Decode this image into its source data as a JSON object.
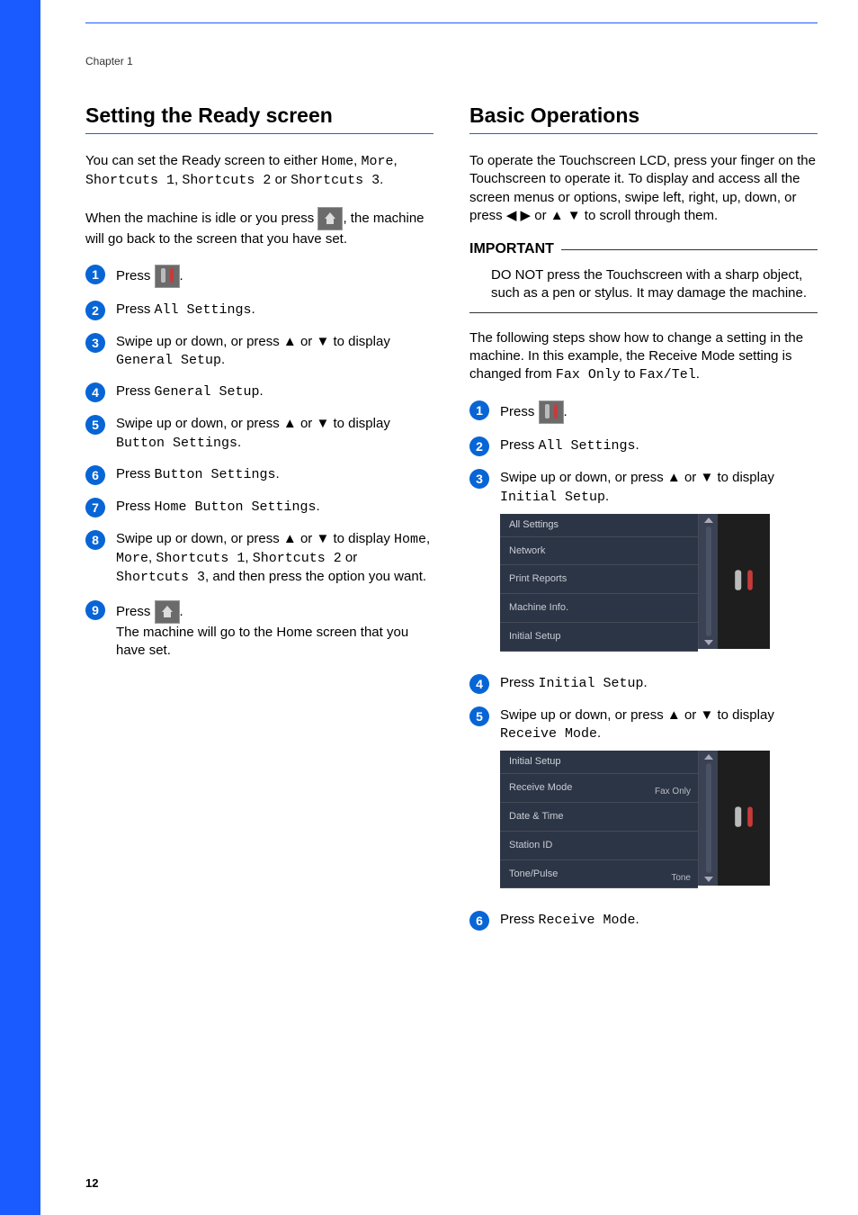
{
  "chapter": "Chapter 1",
  "pageNumber": "12",
  "left": {
    "heading": "Setting the Ready screen",
    "intro_a": "You can set the Ready screen to either ",
    "intro_b": ", ",
    "intro_c": ", ",
    "intro_d": " or ",
    "intro_e": ".",
    "opt_home": "Home",
    "opt_more": "More",
    "opt_s1": "Shortcuts 1",
    "opt_s2": "Shortcuts 2",
    "opt_s3": "Shortcuts 3",
    "idle_a": "When the machine is idle or you press ",
    "idle_b": ", the machine will go back to the screen that you have set.",
    "steps": {
      "s1_a": "Press ",
      "s1_b": ".",
      "s2_a": "Press ",
      "s2_mono": "All Settings",
      "s2_b": ".",
      "s3_a": "Swipe up or down, or press ▲ or ▼ to display ",
      "s3_mono": "General Setup",
      "s3_b": ".",
      "s4_a": "Press ",
      "s4_mono": "General Setup",
      "s4_b": ".",
      "s5_a": "Swipe up or down, or press ▲ or ▼ to display ",
      "s5_mono": "Button Settings",
      "s5_b": ".",
      "s6_a": "Press ",
      "s6_mono": "Button Settings",
      "s6_b": ".",
      "s7_a": "Press ",
      "s7_mono": "Home Button Settings",
      "s7_b": ".",
      "s8_a": "Swipe up or down, or press ▲ or ▼ to display ",
      "s8_m1": "Home",
      "s8_b": ", ",
      "s8_m2": "More",
      "s8_c": ", ",
      "s8_m3": "Shortcuts 1",
      "s8_d": ", ",
      "s8_m4": "Shortcuts 2",
      "s8_e": " or ",
      "s8_m5": "Shortcuts 3",
      "s8_f": ", and then press the option you want.",
      "s9_a": "Press ",
      "s9_b": ".",
      "s9_c": "The machine will go to the Home screen that you have set."
    }
  },
  "right": {
    "heading": "Basic Operations",
    "intro": "To operate the Touchscreen LCD, press your finger on the Touchscreen to operate it. To display and access all the screen menus or options, swipe left, right, up, down, or press ◀ ▶ or ▲ ▼ to scroll through them.",
    "important_title": "IMPORTANT",
    "important_body": "DO NOT press the Touchscreen with a sharp object, such as a pen or stylus. It may damage the machine.",
    "intro2_a": "The following steps show how to change a setting in the machine. In this example, the Receive Mode setting is changed from ",
    "intro2_m1": "Fax Only",
    "intro2_b": " to ",
    "intro2_m2": "Fax/Tel",
    "intro2_c": ".",
    "steps": {
      "s1_a": "Press ",
      "s1_b": ".",
      "s2_a": "Press ",
      "s2_mono": "All Settings",
      "s2_b": ".",
      "s3_a": "Swipe up or down, or press ▲ or ▼ to display ",
      "s3_mono": "Initial Setup",
      "s3_b": ".",
      "s4_a": "Press ",
      "s4_mono": "Initial Setup",
      "s4_b": ".",
      "s5_a": "Swipe up or down, or press ▲ or ▼ to display ",
      "s5_mono": "Receive Mode",
      "s5_b": ".",
      "s6_a": "Press ",
      "s6_mono": "Receive Mode",
      "s6_b": "."
    },
    "screen1": {
      "header": "All Settings",
      "items": [
        "Network",
        "Print Reports",
        "Machine Info.",
        "Initial Setup"
      ]
    },
    "screen2": {
      "header": "Initial Setup",
      "items": [
        {
          "label": "Receive Mode",
          "value": "Fax Only"
        },
        {
          "label": "Date & Time",
          "value": ""
        },
        {
          "label": "Station ID",
          "value": ""
        },
        {
          "label": "Tone/Pulse",
          "value": "Tone"
        }
      ]
    }
  }
}
